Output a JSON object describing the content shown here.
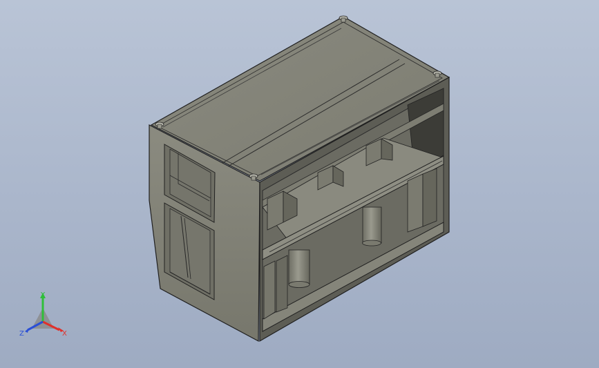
{
  "viewport": {
    "background_top": "#b9c4d6",
    "background_bottom": "#9eabc2"
  },
  "model": {
    "description_icon": "press-frame-assembly-icon",
    "body_color": "#7b7b6f",
    "top_color": "#85857a",
    "edge_color": "#222222",
    "shadow_color": "#3b3b3b"
  },
  "triad": {
    "x_label": "X",
    "y_label": "Y",
    "z_label": "Z",
    "x_color": "#e0302a",
    "y_color": "#2fbf3a",
    "z_color": "#2a4fd6"
  }
}
